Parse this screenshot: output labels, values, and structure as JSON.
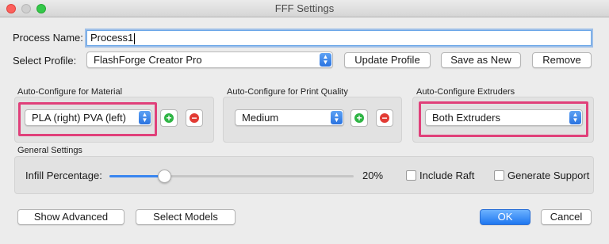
{
  "window": {
    "title": "FFF Settings"
  },
  "process": {
    "label": "Process Name:",
    "value": "Process1"
  },
  "profile": {
    "label": "Select Profile:",
    "selected": "FlashForge Creator Pro",
    "update_label": "Update Profile",
    "save_new_label": "Save as New",
    "remove_label": "Remove"
  },
  "material": {
    "title": "Auto-Configure for Material",
    "selected": "PLA (right) PVA (left)"
  },
  "quality": {
    "title": "Auto-Configure for Print Quality",
    "selected": "Medium"
  },
  "extruders": {
    "title": "Auto-Configure Extruders",
    "selected": "Both Extruders"
  },
  "general": {
    "title": "General Settings",
    "infill_label": "Infill Percentage:",
    "infill_value": "20%",
    "infill_fraction": 0.2,
    "raft_label": "Include Raft",
    "raft_checked": false,
    "support_label": "Generate Support",
    "support_checked": false
  },
  "footer": {
    "show_advanced_label": "Show Advanced",
    "select_models_label": "Select Models",
    "ok_label": "OK",
    "cancel_label": "Cancel"
  },
  "colors": {
    "highlight": "#e0407a",
    "accent": "#2a73e0"
  }
}
